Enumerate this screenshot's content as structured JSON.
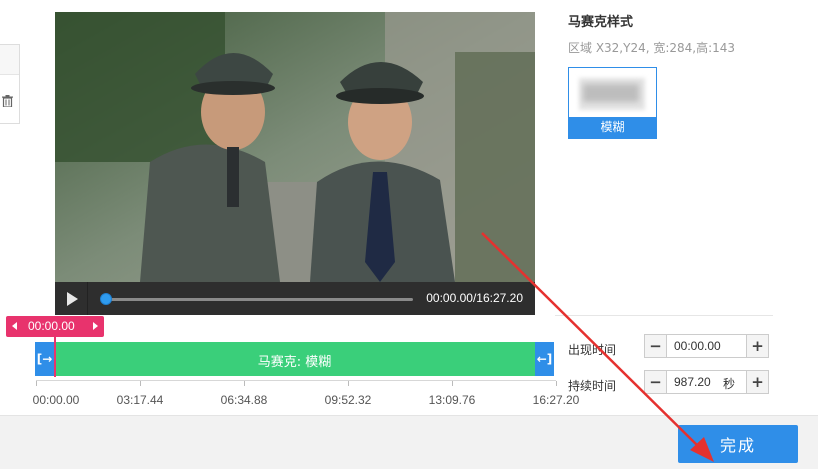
{
  "player": {
    "time_readout": "00:00.00/16:27.20",
    "progress_fraction": 0.0
  },
  "timeline": {
    "playhead_time": "00:00.00",
    "clip_label": "马赛克: 模糊",
    "ticks": [
      "00:00.00",
      "03:17.44",
      "06:34.88",
      "09:52.32",
      "13:09.76",
      "16:27.20"
    ]
  },
  "panel": {
    "title": "马赛克样式",
    "region": "区域 X32,Y24, 宽:284,高:143",
    "effect_label": "模糊"
  },
  "fields": {
    "appear_label": "出现时间",
    "appear_value": "00:00.00",
    "duration_label": "持续时间",
    "duration_value": "987.20",
    "duration_unit": "秒"
  },
  "footer": {
    "done_label": "完成"
  },
  "colors": {
    "accent_blue": "#2f8ee8",
    "clip_green": "#3acf7a",
    "playhead_pink": "#e8336d",
    "arrow_red": "#e5312f"
  }
}
